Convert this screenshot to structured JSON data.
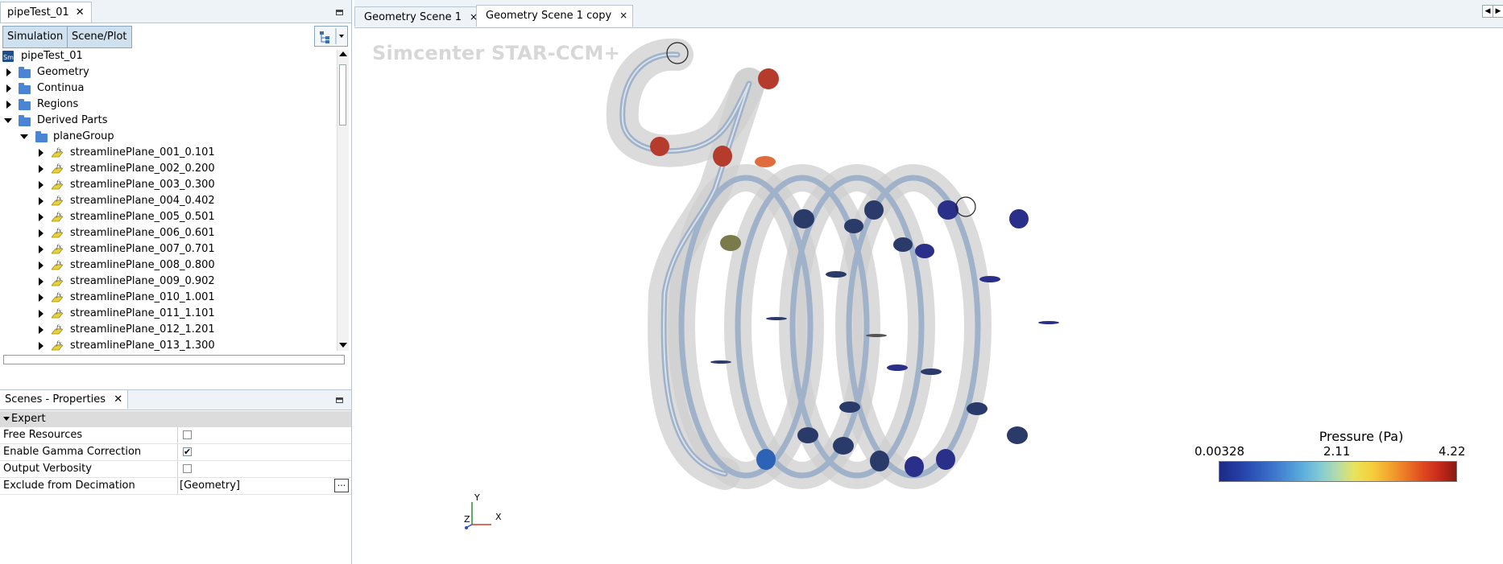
{
  "left_panel": {
    "tab_label": "pipeTest_01",
    "close_glyph": "✕",
    "toolbar": {
      "simulation_label": "Simulation",
      "scene_plot_label": "Scene/Plot"
    },
    "tree": {
      "root": "pipeTest_01",
      "root_icon_text": "Sm",
      "nodes": [
        "Geometry",
        "Continua",
        "Regions",
        "Derived Parts"
      ],
      "group": "planeGroup",
      "planes": [
        "streamlinePlane_001_0.101",
        "streamlinePlane_002_0.200",
        "streamlinePlane_003_0.300",
        "streamlinePlane_004_0.402",
        "streamlinePlane_005_0.501",
        "streamlinePlane_006_0.601",
        "streamlinePlane_007_0.701",
        "streamlinePlane_008_0.800",
        "streamlinePlane_009_0.902",
        "streamlinePlane_010_1.001",
        "streamlinePlane_011_1.101",
        "streamlinePlane_012_1.201",
        "streamlinePlane_013_1.300"
      ]
    }
  },
  "properties": {
    "tab_label": "Scenes - Properties",
    "close_glyph": "✕",
    "section": "Expert",
    "rows": [
      {
        "label": "Free Resources",
        "checked": false
      },
      {
        "label": "Enable Gamma Correction",
        "checked": true,
        "check_glyph": "✔"
      },
      {
        "label": "Output Verbosity",
        "checked": false
      },
      {
        "label": "Exclude from Decimation",
        "value": "[Geometry]",
        "button": "..."
      }
    ]
  },
  "viewer": {
    "tabs": [
      {
        "label": "Geometry Scene 1",
        "close": "×"
      },
      {
        "label": "Geometry Scene 1 copy",
        "close": "×"
      }
    ],
    "brand": "Simcenter STAR-CCM+",
    "axes": {
      "x": "X",
      "y": "Y",
      "z": "Z"
    },
    "legend": {
      "title": "Pressure (Pa)",
      "min": "0.00328",
      "mid": "2.11",
      "max": "4.22",
      "colors": [
        "#1b2a86",
        "#243aa0",
        "#2c54b8",
        "#3a6fc8",
        "#4a8fd6",
        "#5fb0dc",
        "#84cbd4",
        "#b5dca8",
        "#e8e35a",
        "#f6cf3c",
        "#f3a82f",
        "#ec7a26",
        "#e04a1f",
        "#c8291a",
        "#8a1a12"
      ]
    }
  }
}
